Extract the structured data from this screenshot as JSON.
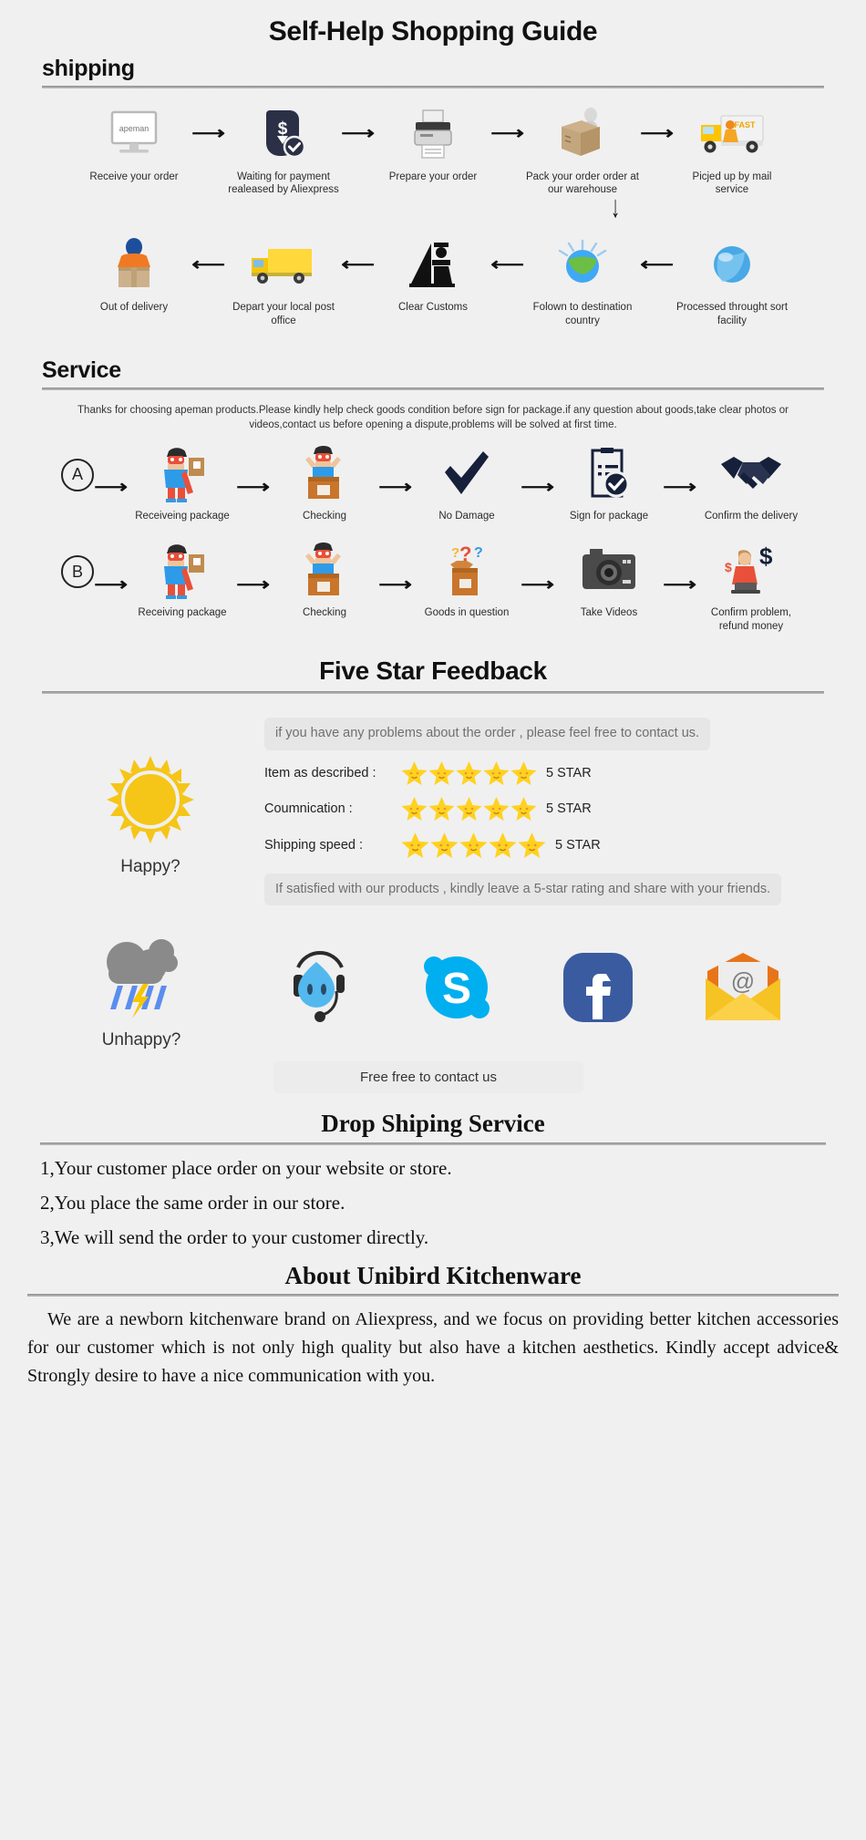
{
  "title": "Self-Help Shopping Guide",
  "sections": {
    "shipping": {
      "heading": "shipping"
    },
    "service": {
      "heading": "Service",
      "note": "Thanks for choosing apeman products.Please kindly help check goods condition before sign for package.if any question about goods,take clear photos or videos,contact us before opening a dispute,problems will be solved at first time."
    },
    "feedback": {
      "heading": "Five Star Feedback"
    },
    "dropshipping": {
      "heading": "Drop Shiping Service"
    },
    "about": {
      "heading": "About Unibird Kitchenware",
      "paragraph": "We are a newborn kitchenware brand on Aliexpress, and we focus on providing better kitchen accessories for our customer which is not only high quality but also have a kitchen aesthetics. Kindly accept advice& Strongly desire to have a nice communication with you."
    }
  },
  "shipping_row1": [
    {
      "label": "Receive your order",
      "icon": "monitor-apeman-icon",
      "brand": "apeman"
    },
    {
      "label": "Waiting for payment realeased by Aliexpress",
      "icon": "payment-shield-icon"
    },
    {
      "label": "Prepare your order",
      "icon": "printer-icon"
    },
    {
      "label": "Pack your order order at our warehouse",
      "icon": "packing-box-icon"
    },
    {
      "label": "Picjed up by mail service",
      "icon": "delivery-truck-icon",
      "brand": "FAST"
    }
  ],
  "shipping_row2": [
    {
      "label": "Out of delivery",
      "icon": "courier-delivery-icon"
    },
    {
      "label": "Depart your local post office",
      "icon": "post-truck-icon"
    },
    {
      "label": "Clear Customs",
      "icon": "customs-officer-icon"
    },
    {
      "label": "Folown to destination country",
      "icon": "globe-airmail-icon"
    },
    {
      "label": "Processed throught sort facility",
      "icon": "globe-sort-icon"
    }
  ],
  "service_row_a": {
    "badge": "A",
    "steps": [
      {
        "label": "Receiveing package",
        "icon": "hero-with-parcel-icon"
      },
      {
        "label": "Checking",
        "icon": "hero-opening-box-icon"
      },
      {
        "label": "No Damage",
        "icon": "checkmark-icon"
      },
      {
        "label": "Sign for package",
        "icon": "signed-document-icon"
      },
      {
        "label": "Confirm the delivery",
        "icon": "handshake-icon"
      }
    ]
  },
  "service_row_b": {
    "badge": "B",
    "steps": [
      {
        "label": "Receiving package",
        "icon": "hero-with-parcel-icon"
      },
      {
        "label": "Checking",
        "icon": "hero-opening-box-icon"
      },
      {
        "label": "Goods in question",
        "icon": "question-box-icon"
      },
      {
        "label": "Take Videos",
        "icon": "camera-icon"
      },
      {
        "label": "Confirm problem, refund money",
        "icon": "refund-agent-icon"
      }
    ]
  },
  "feedback": {
    "happy_label": "Happy?",
    "unhappy_label": "Unhappy?",
    "top_bubble": "if you have any problems about the order , please feel free to contact us.",
    "bottom_bubble": "If satisfied with our products , kindly leave a 5-star rating and share with your friends.",
    "ratings": [
      {
        "label": "Item as described :",
        "stars": 5,
        "value": "5 STAR"
      },
      {
        "label": "Coumnication :",
        "stars": 5,
        "value": "5 STAR"
      },
      {
        "label": "Shipping speed :",
        "stars": 5,
        "value": "5 STAR"
      }
    ],
    "contact_bar": "Free free to contact us",
    "contact_icons": [
      {
        "name": "aliwangwang-icon"
      },
      {
        "name": "skype-icon"
      },
      {
        "name": "facebook-icon"
      },
      {
        "name": "email-icon"
      }
    ]
  },
  "dropshipping_steps": [
    "1,Your customer place order on your website or store.",
    "2,You place the same order in our store.",
    "3,We will send the order to your customer directly."
  ],
  "colors": {
    "background": "#f0f0f0",
    "star_yellow": "#FFD21E",
    "sun_yellow": "#F5C518",
    "skype_blue": "#00AFF0",
    "facebook_blue": "#3A5BA0",
    "email_yellow": "#F6C324",
    "truck_yellow": "#F7C600",
    "bubble_grey": "#e6e6e6"
  }
}
